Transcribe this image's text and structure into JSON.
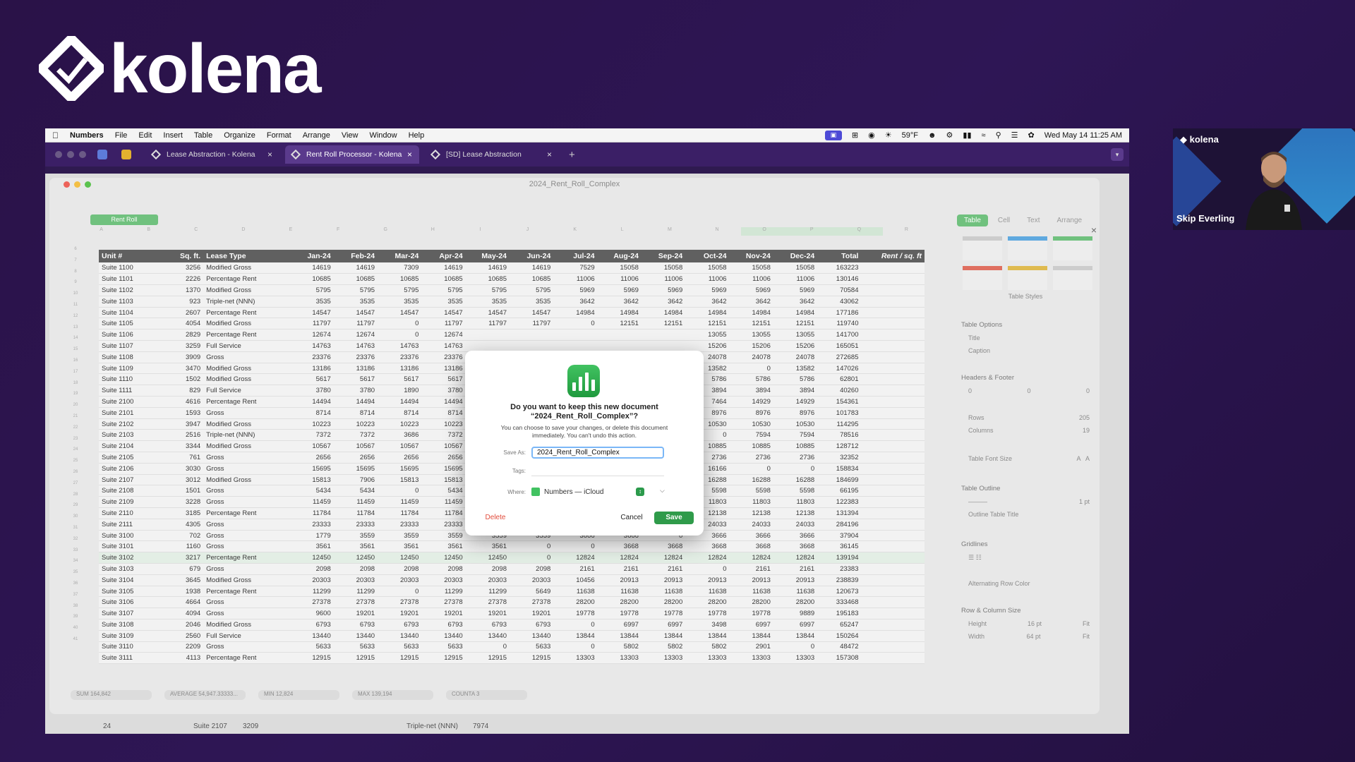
{
  "brand": {
    "name": "kolena"
  },
  "menubar": {
    "items": [
      "Numbers",
      "File",
      "Edit",
      "Insert",
      "Table",
      "Organize",
      "Format",
      "Arrange",
      "View",
      "Window",
      "Help"
    ],
    "temperature": "59°F",
    "datetime": "Wed May 14  11:25 AM"
  },
  "browser": {
    "tabs": [
      {
        "label": "Lease Abstraction - Kolena",
        "active": false
      },
      {
        "label": "Rent Roll Processor - Kolena",
        "active": true
      },
      {
        "label": "[SD] Lease Abstraction",
        "active": false
      }
    ]
  },
  "numbers": {
    "document_title": "2024_Rent_Roll_Complex",
    "sheet_tab": "Rent Roll",
    "column_letters": [
      "A",
      "B",
      "C",
      "D",
      "E",
      "F",
      "G",
      "H",
      "I",
      "J",
      "K",
      "L",
      "M",
      "N",
      "O",
      "P",
      "Q",
      "R"
    ],
    "table": {
      "headers": [
        "Unit #",
        "Sq. ft.",
        "Lease Type",
        "Jan-24",
        "Feb-24",
        "Mar-24",
        "Apr-24",
        "May-24",
        "Jun-24",
        "Jul-24",
        "Aug-24",
        "Sep-24",
        "Oct-24",
        "Nov-24",
        "Dec-24",
        "Total",
        "Rent / sq. ft"
      ],
      "rows": [
        [
          "Suite 1100",
          "3256",
          "Modified Gross",
          "14619",
          "14619",
          "7309",
          "14619",
          "14619",
          "14619",
          "7529",
          "15058",
          "15058",
          "15058",
          "15058",
          "15058",
          "163223",
          ""
        ],
        [
          "Suite 1101",
          "2226",
          "Percentage Rent",
          "10685",
          "10685",
          "10685",
          "10685",
          "10685",
          "10685",
          "11006",
          "11006",
          "11006",
          "11006",
          "11006",
          "11006",
          "130146",
          ""
        ],
        [
          "Suite 1102",
          "1370",
          "Modified Gross",
          "5795",
          "5795",
          "5795",
          "5795",
          "5795",
          "5795",
          "5969",
          "5969",
          "5969",
          "5969",
          "5969",
          "5969",
          "70584",
          ""
        ],
        [
          "Suite 1103",
          "923",
          "Triple-net (NNN)",
          "3535",
          "3535",
          "3535",
          "3535",
          "3535",
          "3535",
          "3642",
          "3642",
          "3642",
          "3642",
          "3642",
          "3642",
          "43062",
          ""
        ],
        [
          "Suite 1104",
          "2607",
          "Percentage Rent",
          "14547",
          "14547",
          "14547",
          "14547",
          "14547",
          "14547",
          "14984",
          "14984",
          "14984",
          "14984",
          "14984",
          "14984",
          "177186",
          ""
        ],
        [
          "Suite 1105",
          "4054",
          "Modified Gross",
          "11797",
          "11797",
          "0",
          "11797",
          "11797",
          "11797",
          "0",
          "12151",
          "12151",
          "12151",
          "12151",
          "12151",
          "119740",
          ""
        ],
        [
          "Suite 1106",
          "2829",
          "Percentage Rent",
          "12674",
          "12674",
          "0",
          "12674",
          "",
          "",
          "",
          "",
          "",
          "13055",
          "13055",
          "13055",
          "141700",
          ""
        ],
        [
          "Suite 1107",
          "3259",
          "Full Service",
          "14763",
          "14763",
          "14763",
          "14763",
          "",
          "",
          "",
          "",
          "",
          "15206",
          "15206",
          "15206",
          "165051",
          ""
        ],
        [
          "Suite 1108",
          "3909",
          "Gross",
          "23376",
          "23376",
          "23376",
          "23376",
          "",
          "",
          "",
          "",
          "",
          "24078",
          "24078",
          "24078",
          "272685",
          ""
        ],
        [
          "Suite 1109",
          "3470",
          "Modified Gross",
          "13186",
          "13186",
          "13186",
          "13186",
          "",
          "",
          "",
          "",
          "",
          "13582",
          "0",
          "13582",
          "147026",
          ""
        ],
        [
          "Suite 1110",
          "1502",
          "Modified Gross",
          "5617",
          "5617",
          "5617",
          "5617",
          "",
          "",
          "",
          "",
          "",
          "5786",
          "5786",
          "5786",
          "62801",
          ""
        ],
        [
          "Suite 1111",
          "829",
          "Full Service",
          "3780",
          "3780",
          "1890",
          "3780",
          "",
          "",
          "",
          "",
          "",
          "3894",
          "3894",
          "3894",
          "40260",
          ""
        ],
        [
          "Suite 2100",
          "4616",
          "Percentage Rent",
          "14494",
          "14494",
          "14494",
          "14494",
          "",
          "",
          "",
          "",
          "",
          "7464",
          "14929",
          "14929",
          "154361",
          ""
        ],
        [
          "Suite 2101",
          "1593",
          "Gross",
          "8714",
          "8714",
          "8714",
          "8714",
          "",
          "",
          "",
          "",
          "",
          "8976",
          "8976",
          "8976",
          "101783",
          ""
        ],
        [
          "Suite 2102",
          "3947",
          "Modified Gross",
          "10223",
          "10223",
          "10223",
          "10223",
          "",
          "",
          "",
          "",
          "",
          "10530",
          "10530",
          "10530",
          "114295",
          ""
        ],
        [
          "Suite 2103",
          "2516",
          "Triple-net (NNN)",
          "7372",
          "7372",
          "3686",
          "7372",
          "",
          "",
          "",
          "",
          "",
          "0",
          "7594",
          "7594",
          "78516",
          ""
        ],
        [
          "Suite 2104",
          "3344",
          "Modified Gross",
          "10567",
          "10567",
          "10567",
          "10567",
          "",
          "",
          "",
          "",
          "",
          "10885",
          "10885",
          "10885",
          "128712",
          ""
        ],
        [
          "Suite 2105",
          "761",
          "Gross",
          "2656",
          "2656",
          "2656",
          "2656",
          "",
          "",
          "",
          "",
          "",
          "2736",
          "2736",
          "2736",
          "32352",
          ""
        ],
        [
          "Suite 2106",
          "3030",
          "Gross",
          "15695",
          "15695",
          "15695",
          "15695",
          "",
          "",
          "",
          "",
          "",
          "16166",
          "0",
          "0",
          "158834",
          ""
        ],
        [
          "Suite 2107",
          "3012",
          "Modified Gross",
          "15813",
          "7906",
          "15813",
          "15813",
          "",
          "",
          "",
          "",
          "",
          "16288",
          "16288",
          "16288",
          "184699",
          ""
        ],
        [
          "Suite 2108",
          "1501",
          "Gross",
          "5434",
          "5434",
          "0",
          "5434",
          "",
          "",
          "",
          "",
          "",
          "5598",
          "5598",
          "5598",
          "66195",
          ""
        ],
        [
          "Suite 2109",
          "3228",
          "Gross",
          "11459",
          "11459",
          "11459",
          "11459",
          "",
          "",
          "",
          "",
          "",
          "11803",
          "11803",
          "11803",
          "122383",
          ""
        ],
        [
          "Suite 2110",
          "3185",
          "Percentage Rent",
          "11784",
          "11784",
          "11784",
          "11784",
          "",
          "",
          "",
          "",
          "",
          "12138",
          "12138",
          "12138",
          "131394",
          ""
        ],
        [
          "Suite 2111",
          "4305",
          "Gross",
          "23333",
          "23333",
          "23333",
          "23333",
          "23333",
          "23333",
          "24033",
          "24033",
          "24033",
          "24033",
          "24033",
          "24033",
          "284196",
          ""
        ],
        [
          "Suite 3100",
          "702",
          "Gross",
          "1779",
          "3559",
          "3559",
          "3559",
          "3559",
          "3559",
          "3666",
          "3666",
          "0",
          "3666",
          "3666",
          "3666",
          "37904",
          ""
        ],
        [
          "Suite 3101",
          "1160",
          "Gross",
          "3561",
          "3561",
          "3561",
          "3561",
          "3561",
          "0",
          "0",
          "3668",
          "3668",
          "3668",
          "3668",
          "3668",
          "36145",
          ""
        ],
        [
          "Suite 3102",
          "3217",
          "Percentage Rent",
          "12450",
          "12450",
          "12450",
          "12450",
          "12450",
          "0",
          "12824",
          "12824",
          "12824",
          "12824",
          "12824",
          "12824",
          "139194",
          ""
        ],
        [
          "Suite 3103",
          "679",
          "Gross",
          "2098",
          "2098",
          "2098",
          "2098",
          "2098",
          "2098",
          "2161",
          "2161",
          "2161",
          "0",
          "2161",
          "2161",
          "23383",
          ""
        ],
        [
          "Suite 3104",
          "3645",
          "Modified Gross",
          "20303",
          "20303",
          "20303",
          "20303",
          "20303",
          "20303",
          "10456",
          "20913",
          "20913",
          "20913",
          "20913",
          "20913",
          "238839",
          ""
        ],
        [
          "Suite 3105",
          "1938",
          "Percentage Rent",
          "11299",
          "11299",
          "0",
          "11299",
          "11299",
          "5649",
          "11638",
          "11638",
          "11638",
          "11638",
          "11638",
          "11638",
          "120673",
          ""
        ],
        [
          "Suite 3106",
          "4664",
          "Gross",
          "27378",
          "27378",
          "27378",
          "27378",
          "27378",
          "27378",
          "28200",
          "28200",
          "28200",
          "28200",
          "28200",
          "28200",
          "333468",
          ""
        ],
        [
          "Suite 3107",
          "4094",
          "Gross",
          "9600",
          "19201",
          "19201",
          "19201",
          "19201",
          "19201",
          "19778",
          "19778",
          "19778",
          "19778",
          "19778",
          "9889",
          "195183",
          ""
        ],
        [
          "Suite 3108",
          "2046",
          "Modified Gross",
          "6793",
          "6793",
          "6793",
          "6793",
          "6793",
          "6793",
          "0",
          "6997",
          "6997",
          "3498",
          "6997",
          "6997",
          "65247",
          ""
        ],
        [
          "Suite 3109",
          "2560",
          "Full Service",
          "13440",
          "13440",
          "13440",
          "13440",
          "13440",
          "13440",
          "13844",
          "13844",
          "13844",
          "13844",
          "13844",
          "13844",
          "150264",
          ""
        ],
        [
          "Suite 3110",
          "2209",
          "Gross",
          "5633",
          "5633",
          "5633",
          "5633",
          "0",
          "5633",
          "0",
          "5802",
          "5802",
          "5802",
          "2901",
          "0",
          "48472",
          ""
        ],
        [
          "Suite 3111",
          "4113",
          "Percentage Rent",
          "12915",
          "12915",
          "12915",
          "12915",
          "12915",
          "12915",
          "13303",
          "13303",
          "13303",
          "13303",
          "13303",
          "13303",
          "157308",
          ""
        ]
      ]
    },
    "status": {
      "sum": "SUM  164,842",
      "average": "AVERAGE  54,947.33333...",
      "min": "MIN  12,824",
      "max": "MAX  139,194",
      "counta": "COUNTA  3"
    },
    "bottom_row": {
      "row": "24",
      "unit": "Suite 2107",
      "sqft": "3209",
      "type": "Triple-net (NNN)",
      "value": "7974"
    },
    "side_panel": {
      "tabs": [
        "Table",
        "Cell",
        "Text",
        "Arrange"
      ],
      "styles_label": "Table Styles",
      "table_options": "Table Options",
      "title_opt": "Title",
      "caption_opt": "Caption",
      "headers_footer": "Headers & Footer",
      "hf_values": [
        "0",
        "0",
        "0"
      ],
      "rows_label": "Rows",
      "rows_value": "205",
      "columns_label": "Columns",
      "columns_value": "19",
      "font_size": "Table Font Size",
      "outline": "Table Outline",
      "outline_pt": "1 pt",
      "outline_title": "Outline Table Title",
      "gridlines": "Gridlines",
      "alt_row": "Alternating Row Color",
      "row_col_size": "Row & Column Size",
      "height_label": "Height",
      "height_value": "16 pt",
      "width_label": "Width",
      "width_value": "64 pt",
      "fit": "Fit"
    }
  },
  "dialog": {
    "title": "Do you want to keep this new document “2024_Rent_Roll_Complex”?",
    "body": "You can choose to save your changes, or delete this document immediately. You can't undo this action.",
    "save_as_label": "Save As:",
    "save_as_value": "2024_Rent_Roll_Complex",
    "tags_label": "Tags:",
    "where_label": "Where:",
    "where_value": "Numbers — iCloud",
    "delete_label": "Delete",
    "cancel_label": "Cancel",
    "save_label": "Save"
  },
  "presenter": {
    "logo": "kolena",
    "name": "Skip Everling"
  },
  "colors": {
    "background": "#2a1248",
    "numbers_green": "#6cc07b",
    "save_button": "#2f9b4a",
    "delete_text": "#e24b3b"
  }
}
